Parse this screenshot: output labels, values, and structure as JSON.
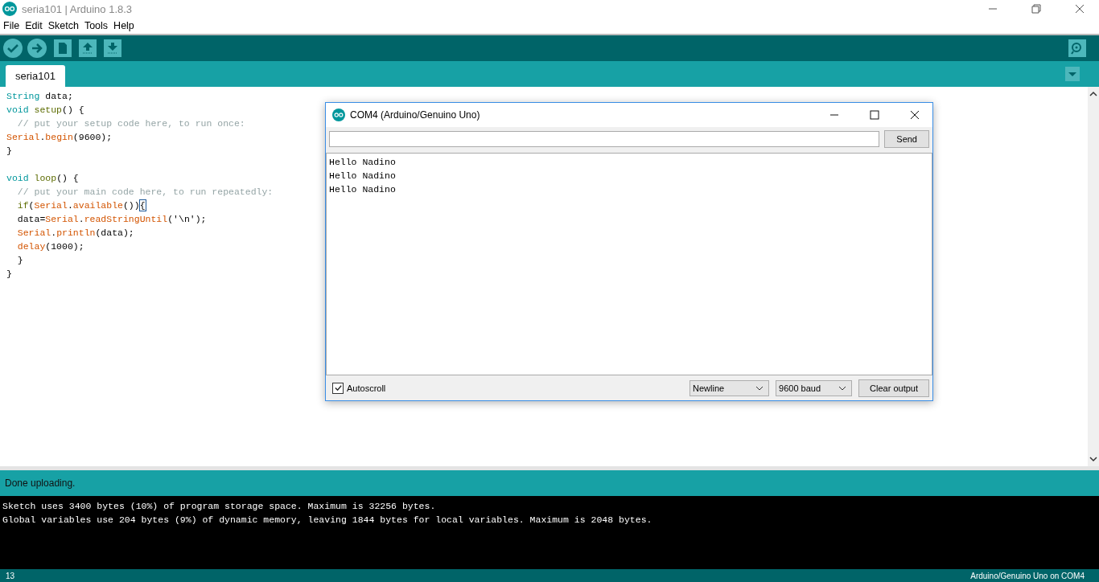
{
  "window": {
    "title": "seria101 | Arduino 1.8.3"
  },
  "menu": [
    "File",
    "Edit",
    "Sketch",
    "Tools",
    "Help"
  ],
  "toolbar": [
    {
      "kind": "verify"
    },
    {
      "kind": "upload"
    },
    {
      "kind": "new"
    },
    {
      "kind": "open"
    },
    {
      "kind": "save"
    }
  ],
  "tabs": [
    {
      "label": "seria101",
      "selected": true
    }
  ],
  "code": [
    {
      "tokens": [
        {
          "text": "String",
          "kind": "type"
        },
        {
          "text": " data;",
          "kind": "plain"
        }
      ]
    },
    {
      "tokens": [
        {
          "text": "void",
          "kind": "type"
        },
        {
          "text": " setup",
          "kind": "fn"
        },
        {
          "text": "() {",
          "kind": "plain"
        }
      ]
    },
    {
      "tokens": [
        {
          "text": "  // put your setup code here, to run once:",
          "kind": "comment"
        }
      ]
    },
    {
      "tokens": [
        {
          "text": "Serial",
          "kind": "builtin"
        },
        {
          "text": ".",
          "kind": "plain"
        },
        {
          "text": "begin",
          "kind": "builtin"
        },
        {
          "text": "(9600);",
          "kind": "plain"
        }
      ]
    },
    {
      "tokens": [
        {
          "text": "}",
          "kind": "plain"
        }
      ]
    },
    {
      "blank_before": true,
      "tokens": [
        {
          "text": "void",
          "kind": "type"
        },
        {
          "text": " loop",
          "kind": "fn"
        },
        {
          "text": "() {",
          "kind": "plain"
        }
      ]
    },
    {
      "tokens": [
        {
          "text": "  // put your main code here, to run repeatedly:",
          "kind": "comment"
        }
      ]
    },
    {
      "tokens": [
        {
          "text": "  if",
          "kind": "fn"
        },
        {
          "text": "(",
          "kind": "plain"
        },
        {
          "text": "Serial",
          "kind": "builtin"
        },
        {
          "text": ".",
          "kind": "plain"
        },
        {
          "text": "available",
          "kind": "builtin"
        },
        {
          "text": "())",
          "kind": "plain"
        },
        {
          "text": "{",
          "kind": "match"
        }
      ]
    },
    {
      "tokens": [
        {
          "text": "  data=",
          "kind": "plain"
        },
        {
          "text": "Serial",
          "kind": "builtin"
        },
        {
          "text": ".",
          "kind": "plain"
        },
        {
          "text": "readStringUntil",
          "kind": "builtin"
        },
        {
          "text": "('\\n');",
          "kind": "plain"
        }
      ]
    },
    {
      "tokens": [
        {
          "text": "  Serial",
          "kind": "builtin"
        },
        {
          "text": ".",
          "kind": "plain"
        },
        {
          "text": "println",
          "kind": "builtin"
        },
        {
          "text": "(data);",
          "kind": "plain"
        }
      ]
    },
    {
      "tokens": [
        {
          "text": "  delay",
          "kind": "builtin"
        },
        {
          "text": "(1000);",
          "kind": "plain"
        }
      ]
    },
    {
      "tokens": [
        {
          "text": "  }",
          "kind": "plain"
        }
      ]
    },
    {
      "tokens": [
        {
          "text": "}",
          "kind": "plain"
        }
      ]
    }
  ],
  "serial_monitor": {
    "title": "COM4 (Arduino/Genuino Uno)",
    "send_button": "Send",
    "output": [
      "Hello Nadino",
      "Hello Nadino",
      "Hello Nadino"
    ],
    "autoscroll": {
      "label": "Autoscroll",
      "checked": true
    },
    "line_ending": "Newline",
    "baud": "9600 baud",
    "clear_button": "Clear output"
  },
  "status": "Done uploading.",
  "console": [
    "Sketch uses 3400 bytes (10%) of program storage space. Maximum is 32256 bytes.",
    "Global variables use 204 bytes (9%) of dynamic memory, leaving 1844 bytes for local variables. Maximum is 2048 bytes."
  ],
  "status_bar": {
    "line": "13",
    "board": "Arduino/Genuino Uno on COM4"
  }
}
